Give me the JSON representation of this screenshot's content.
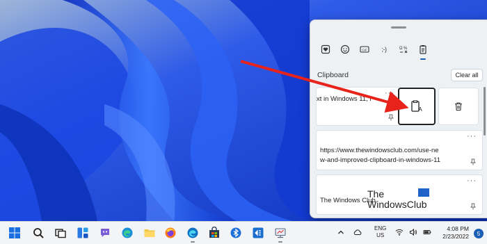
{
  "clipboard": {
    "title": "Clipboard",
    "clear_all_label": "Clear all",
    "more_label": "···",
    "items": [
      {
        "text_line1": "xt in Windows 11, i"
      },
      {
        "text_line1": "https://www.thewindowsclub.com/use-ne",
        "text_line2": "w-and-improved-clipboard-in-windows-11"
      },
      {
        "text_line1": "The Windows Club"
      }
    ],
    "tabs": [
      {
        "icon": "heart-sticker-icon"
      },
      {
        "icon": "emoji-icon"
      },
      {
        "icon": "gif-icon",
        "label": "GIF"
      },
      {
        "icon": "kaomoji-icon",
        "label": ";-)"
      },
      {
        "icon": "symbols-icon"
      },
      {
        "icon": "clipboard-history-icon",
        "active": true
      }
    ]
  },
  "watermark": {
    "line1": "The",
    "line2": "WindowsClub"
  },
  "taskbar": {
    "apps": [
      "start-icon",
      "search-icon",
      "task-view-icon",
      "widgets-icon",
      "teams-chat-icon",
      "edge-icon",
      "file-explorer-icon",
      "firefox-icon",
      "store-icon",
      "bluetooth-icon",
      "app-icon",
      "screen-icon"
    ],
    "language": {
      "line1": "ENG",
      "line2": "US"
    },
    "time": "4:08 PM",
    "date": "2/23/2022",
    "notification_count": "5"
  },
  "colors": {
    "accent": "#1a5fb4",
    "arrow": "#e8231b",
    "wallpaper": "#1a3fd6"
  }
}
